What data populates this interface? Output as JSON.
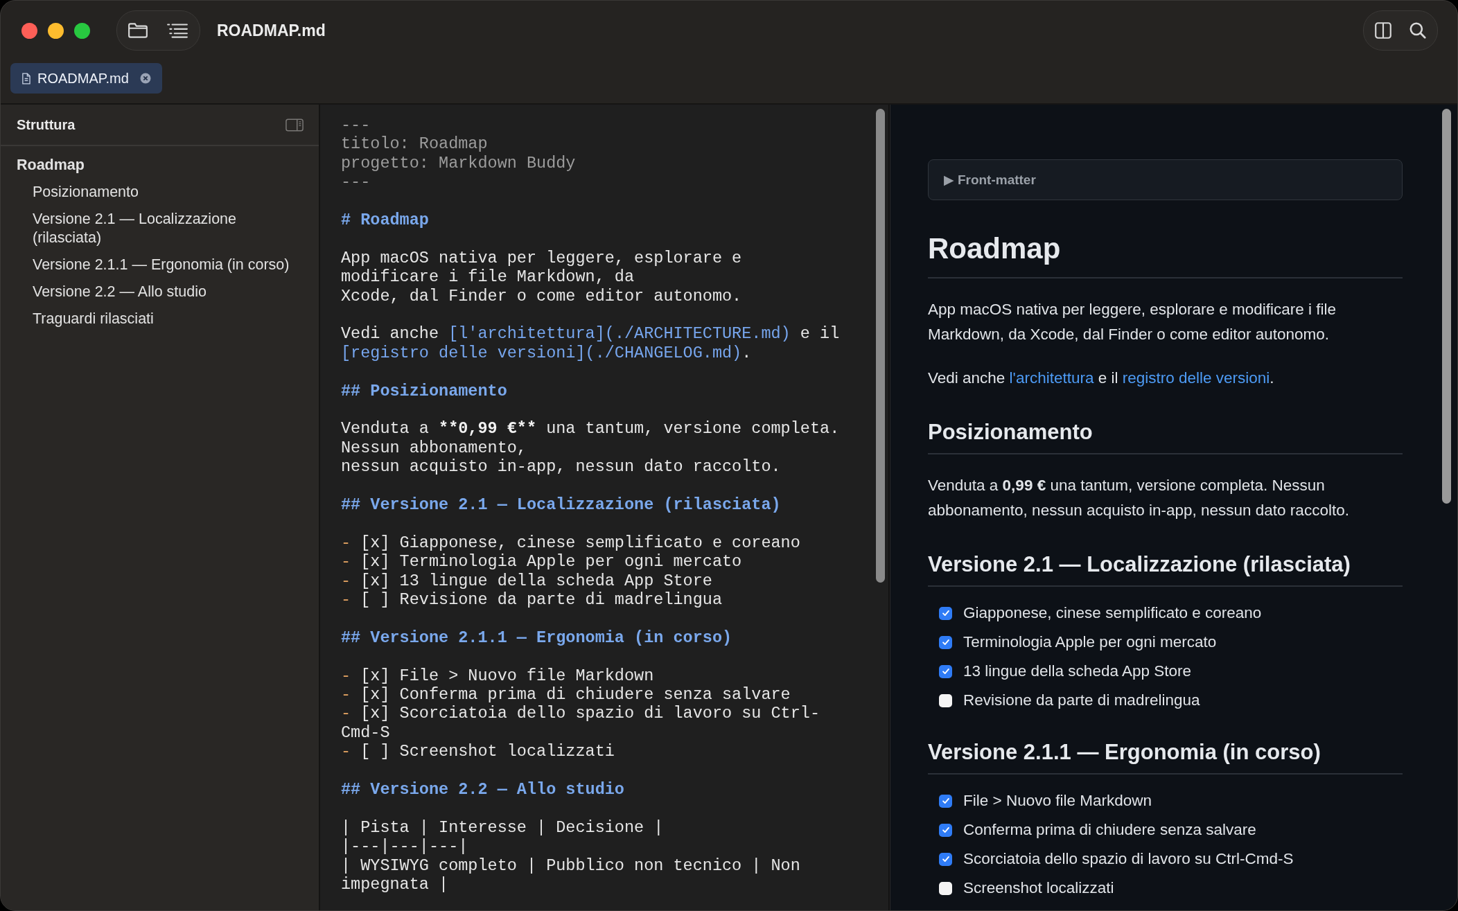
{
  "window": {
    "title": "ROADMAP.md"
  },
  "tabs": [
    {
      "label": "ROADMAP.md",
      "selected": true
    }
  ],
  "sidebar": {
    "title": "Struttura",
    "outline": [
      {
        "label": "Roadmap",
        "children": [
          {
            "label": "Posizionamento"
          },
          {
            "label": "Versione 2.1 — Localizzazione (rilasciata)"
          },
          {
            "label": "Versione 2.1.1 — Ergonomia (in corso)"
          },
          {
            "label": "Versione 2.2 — Allo studio"
          },
          {
            "label": "Traguardi rilasciati"
          }
        ]
      }
    ]
  },
  "editor": {
    "blocks": [
      [
        [
          {
            "kind": "meta",
            "text": "---"
          }
        ],
        [
          {
            "kind": "meta",
            "text": "titolo: Roadmap"
          }
        ],
        [
          {
            "kind": "meta",
            "text": "progetto: Markdown Buddy"
          }
        ],
        [
          {
            "kind": "meta",
            "text": "---"
          }
        ]
      ],
      [
        [
          {
            "kind": "heading",
            "text": "# Roadmap"
          }
        ]
      ],
      [
        [
          {
            "kind": "text",
            "text": "App macOS nativa per leggere, esplorare e"
          }
        ],
        [
          {
            "kind": "text",
            "text": "modificare i file Markdown, da"
          }
        ],
        [
          {
            "kind": "text",
            "text": "Xcode, dal Finder o come editor autonomo."
          }
        ]
      ],
      [
        [
          {
            "kind": "text",
            "text": "Vedi anche "
          },
          {
            "kind": "link",
            "text": "[l'architettura](./ARCHITECTURE.md)"
          },
          {
            "kind": "text",
            "text": " e il"
          }
        ],
        [
          {
            "kind": "link",
            "text": "[registro delle versioni](./CHANGELOG.md)"
          },
          {
            "kind": "text",
            "text": "."
          }
        ]
      ],
      [
        [
          {
            "kind": "heading",
            "text": "## Posizionamento"
          }
        ]
      ],
      [
        [
          {
            "kind": "text",
            "text": "Venduta a "
          },
          {
            "kind": "bold",
            "text": "**0,99 €**"
          },
          {
            "kind": "text",
            "text": " una tantum, versione completa."
          }
        ],
        [
          {
            "kind": "text",
            "text": "Nessun abbonamento,"
          }
        ],
        [
          {
            "kind": "text",
            "text": "nessun acquisto in-app, nessun dato raccolto."
          }
        ]
      ],
      [
        [
          {
            "kind": "heading",
            "text": "## Versione 2.1 — Localizzazione (rilasciata)"
          }
        ]
      ],
      [
        [
          {
            "kind": "marker",
            "text": "-"
          },
          {
            "kind": "text",
            "text": " [x] Giapponese, cinese semplificato e coreano"
          }
        ],
        [
          {
            "kind": "marker",
            "text": "-"
          },
          {
            "kind": "text",
            "text": " [x] Terminologia Apple per ogni mercato"
          }
        ],
        [
          {
            "kind": "marker",
            "text": "-"
          },
          {
            "kind": "text",
            "text": " [x] 13 lingue della scheda App Store"
          }
        ],
        [
          {
            "kind": "marker",
            "text": "-"
          },
          {
            "kind": "text",
            "text": " [ ] Revisione da parte di madrelingua"
          }
        ]
      ],
      [
        [
          {
            "kind": "heading",
            "text": "## Versione 2.1.1 — Ergonomia (in corso)"
          }
        ]
      ],
      [
        [
          {
            "kind": "marker",
            "text": "-"
          },
          {
            "kind": "text",
            "text": " [x] File > Nuovo file Markdown"
          }
        ],
        [
          {
            "kind": "marker",
            "text": "-"
          },
          {
            "kind": "text",
            "text": " [x] Conferma prima di chiudere senza salvare"
          }
        ],
        [
          {
            "kind": "marker",
            "text": "-"
          },
          {
            "kind": "text",
            "text": " [x] Scorciatoia dello spazio di lavoro su Ctrl-"
          }
        ],
        [
          {
            "kind": "text",
            "text": "Cmd-S"
          }
        ],
        [
          {
            "kind": "marker",
            "text": "-"
          },
          {
            "kind": "text",
            "text": " [ ] Screenshot localizzati"
          }
        ]
      ],
      [
        [
          {
            "kind": "heading",
            "text": "## Versione 2.2 — Allo studio"
          }
        ]
      ],
      [
        [
          {
            "kind": "text",
            "text": "| Pista | Interesse | Decisione |"
          }
        ],
        [
          {
            "kind": "text",
            "text": "|---|---|---|"
          }
        ],
        [
          {
            "kind": "text",
            "text": "| WYSIWYG completo | Pubblico non tecnico | Non"
          }
        ],
        [
          {
            "kind": "text",
            "text": "impegnata |"
          }
        ]
      ]
    ]
  },
  "preview": {
    "front_matter": {
      "marker": "▶",
      "label": "Front-matter"
    },
    "blocks": [
      {
        "kind": "h1",
        "text": "Roadmap"
      },
      {
        "kind": "p",
        "segments": [
          {
            "kind": "text",
            "text": "App macOS nativa per leggere, esplorare e modificare i file Markdown, da Xcode, dal Finder o come editor autonomo."
          }
        ]
      },
      {
        "kind": "p",
        "segments": [
          {
            "kind": "text",
            "text": "Vedi anche "
          },
          {
            "kind": "link",
            "text": "l'architettura"
          },
          {
            "kind": "text",
            "text": " e il "
          },
          {
            "kind": "link",
            "text": "registro delle versioni"
          },
          {
            "kind": "text",
            "text": "."
          }
        ]
      },
      {
        "kind": "h2",
        "text": "Posizionamento"
      },
      {
        "kind": "p",
        "segments": [
          {
            "kind": "text",
            "text": "Venduta a **0,99 €** una tantum, versione completa. Nessun abbonamento, nessun acquisto in-app, nessun dato raccolto."
          }
        ]
      },
      {
        "kind": "h2",
        "text": "Versione 2.1 — Localizzazione (rilasciata)"
      },
      {
        "kind": "tasks",
        "items": [
          {
            "text": "Giapponese, cinese semplificato e coreano",
            "checked": true
          },
          {
            "text": "Terminologia Apple per ogni mercato",
            "checked": true
          },
          {
            "text": "13 lingue della scheda App Store",
            "checked": true
          },
          {
            "text": "Revisione da parte di madrelingua",
            "checked": false
          }
        ]
      },
      {
        "kind": "h2",
        "text": "Versione 2.1.1 — Ergonomia (in corso)"
      },
      {
        "kind": "tasks",
        "items": [
          {
            "text": "File > Nuovo file Markdown",
            "checked": true
          },
          {
            "text": "Conferma prima di chiudere senza salvare",
            "checked": true
          },
          {
            "text": "Scorciatoia dello spazio di lavoro su Ctrl-Cmd-S",
            "checked": true
          },
          {
            "text": "Screenshot localizzati",
            "checked": false
          }
        ]
      }
    ]
  }
}
